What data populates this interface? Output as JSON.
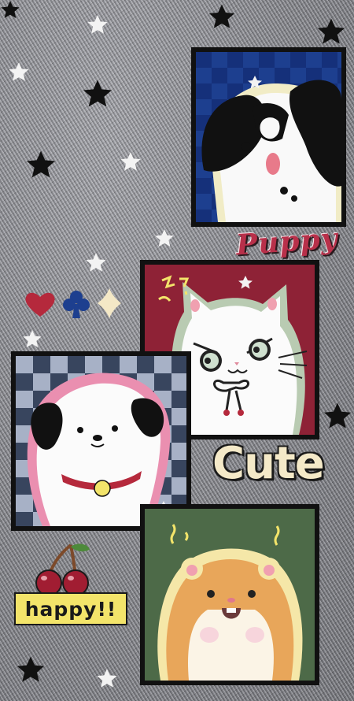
{
  "stickers": {
    "puppy_word": "Puppy",
    "cute_word": "Cute",
    "happy_label": "happy!!"
  },
  "icons": [
    "star-icon",
    "heart-icon",
    "club-icon",
    "diamond-icon",
    "cherry-icon"
  ],
  "colors": {
    "denim": "#8f9096",
    "frame_border": "#111111",
    "navy_check": "#1d3f8f",
    "maroon": "#8e2236",
    "slate_check": "#38455e",
    "olive_green": "#4d6a48",
    "puppy_red": "#b8304a",
    "cute_cream": "#f4e9c8",
    "happy_yellow": "#f3e46a"
  }
}
